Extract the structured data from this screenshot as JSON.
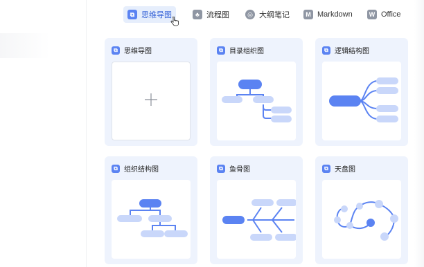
{
  "tabs": [
    {
      "label": "思维导图",
      "icon": "mindmap-icon",
      "glyph": "⧉",
      "active": true
    },
    {
      "label": "流程图",
      "icon": "flowchart-icon",
      "glyph": "♣",
      "active": false
    },
    {
      "label": "大纲笔记",
      "icon": "outline-icon",
      "glyph": "◎",
      "active": false
    },
    {
      "label": "Markdown",
      "icon": "markdown-icon",
      "glyph": "M",
      "active": false
    },
    {
      "label": "Office",
      "icon": "office-icon",
      "glyph": "W",
      "active": false
    }
  ],
  "templates": [
    {
      "title": "思维导图",
      "icon": "mindmap-icon",
      "preview": "blank"
    },
    {
      "title": "目录组织图",
      "icon": "mindmap-icon",
      "preview": "directory"
    },
    {
      "title": "逻辑结构图",
      "icon": "mindmap-icon",
      "preview": "logic"
    },
    {
      "title": "组织结构图",
      "icon": "mindmap-icon",
      "preview": "org"
    },
    {
      "title": "鱼骨图",
      "icon": "mindmap-icon",
      "preview": "fishbone"
    },
    {
      "title": "天盘图",
      "icon": "mindmap-icon",
      "preview": "sky"
    }
  ],
  "colors": {
    "accent": "#5b83f2",
    "node_light": "#c9d7fa",
    "card_bg": "#eef3fd"
  }
}
